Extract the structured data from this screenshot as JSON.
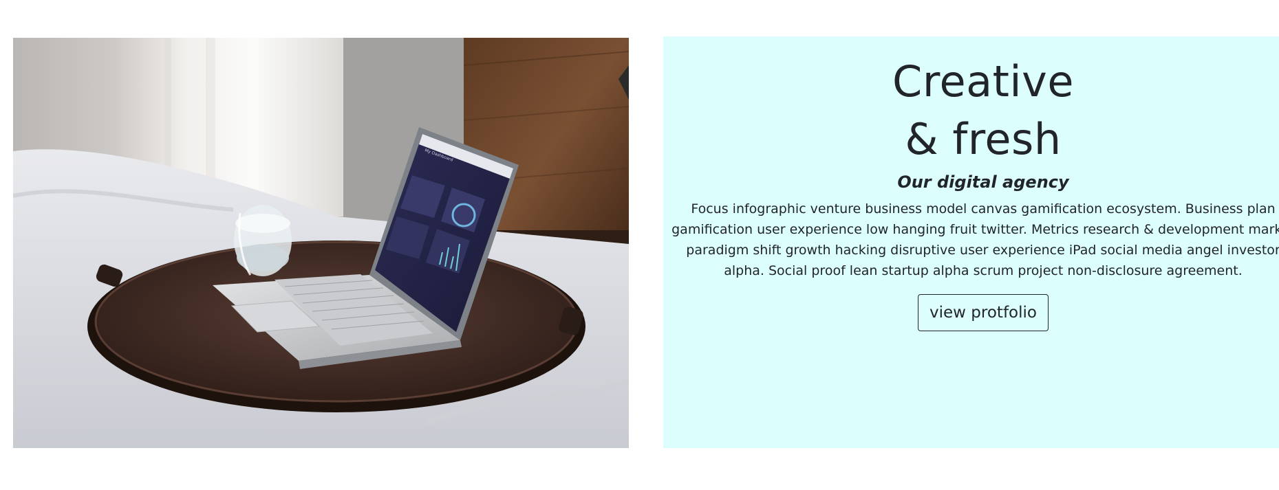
{
  "hero": {
    "headline_line1": "Creative",
    "headline_line2": "& fresh",
    "subheading": "Our digital agency",
    "description": "Focus infographic venture business model canvas gamification ecosystem. Business plan gamification user experience low hanging fruit twitter. Metrics research & development market paradigm shift growth hacking disruptive user experience iPad social media angel investor alpha. Social proof lean startup alpha scrum project non-disclosure agreement.",
    "cta_label": "view protfolio"
  },
  "photo": {
    "screen_title": "My Dashboard"
  },
  "colors": {
    "panel_background": "#dcfffe",
    "text": "#212529",
    "button_border": "#212529"
  }
}
